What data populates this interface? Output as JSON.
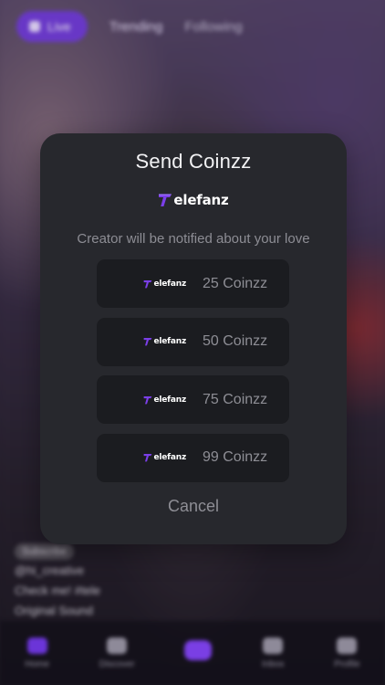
{
  "background": {
    "header": {
      "live_label": "Live",
      "tabs": [
        "Trending",
        "Following"
      ]
    },
    "caption": {
      "chip": "Subscribe",
      "line1": "@hi_creative",
      "line2": "Check me! #tele",
      "line3": "Original Sound"
    },
    "nav": [
      "Home",
      "Discover",
      "",
      "Inbox",
      "Profile"
    ]
  },
  "dialog": {
    "title": "Send Coinzz",
    "brand": "elefanz",
    "subtitle": "Creator will be notified about your love",
    "options": [
      {
        "brand": "elefanz",
        "label": "25 Coinzz"
      },
      {
        "brand": "elefanz",
        "label": "50 Coinzz"
      },
      {
        "brand": "elefanz",
        "label": "75 Coinzz"
      },
      {
        "brand": "elefanz",
        "label": "99 Coinzz"
      }
    ],
    "cancel_label": "Cancel"
  },
  "colors": {
    "dialog_bg": "#27282d",
    "option_bg": "#1b1c20",
    "accent": "#7b3fe8",
    "muted_text": "#8e8e95"
  },
  "icons": {
    "brand_logo": "telefanz-t-logo-icon"
  }
}
